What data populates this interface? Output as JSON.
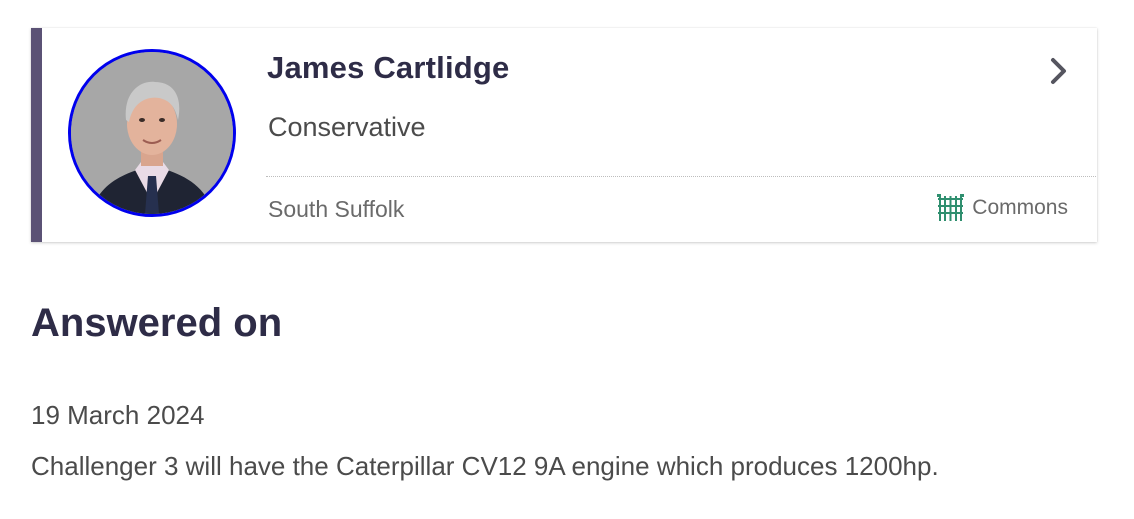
{
  "member": {
    "name": "James Cartlidge",
    "party": "Conservative",
    "constituency": "South Suffolk",
    "house": "Commons",
    "party_color": "#5b5275",
    "avatar_border_color": "#0000ee",
    "house_icon": "portcullis-icon",
    "navigate_icon": "chevron-right-icon"
  },
  "answer": {
    "heading": "Answered on",
    "date": "19 March 2024",
    "text": "Challenger 3 will have the Caterpillar CV12 9A engine which produces 1200hp."
  },
  "colors": {
    "heading_text": "#2e2c47",
    "body_text": "#4b4b4b",
    "house_icon": "#2f8f6f"
  }
}
